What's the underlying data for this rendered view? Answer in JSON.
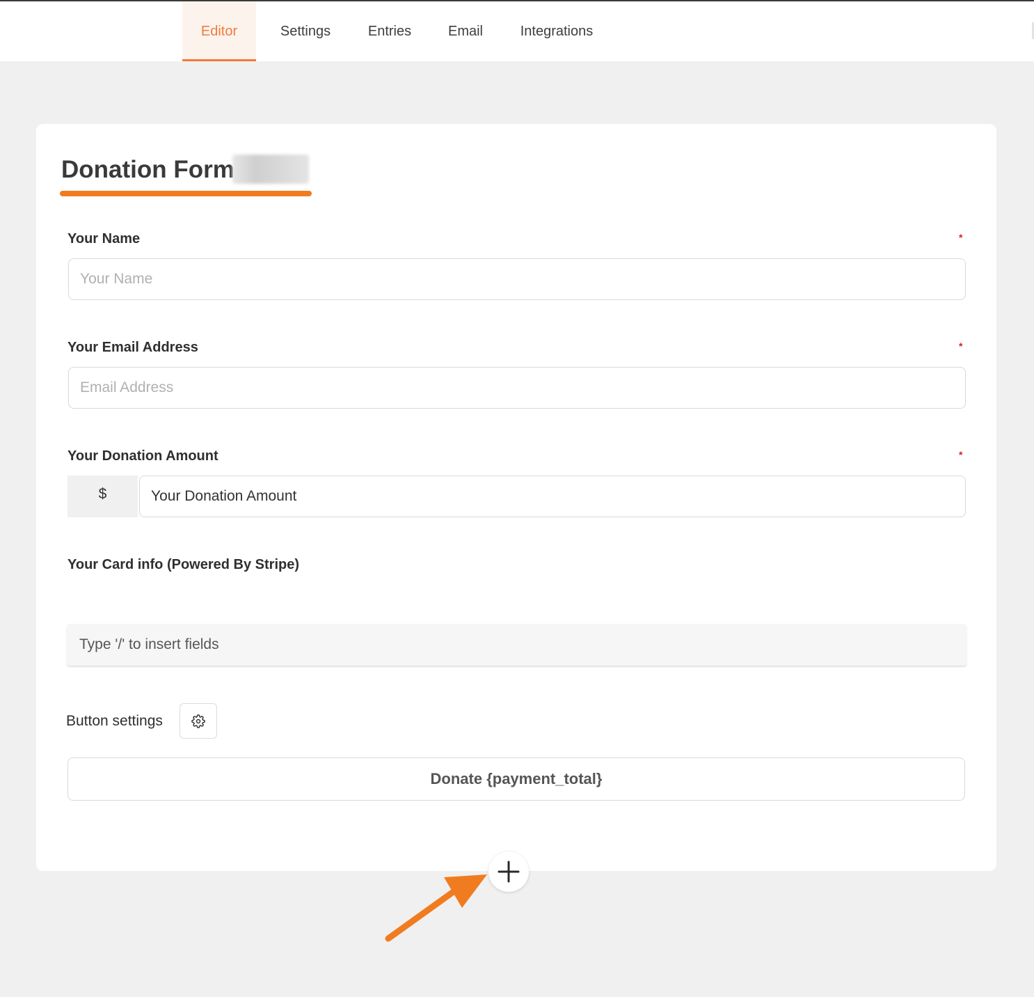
{
  "tabs": [
    {
      "label": "Editor",
      "active": true
    },
    {
      "label": "Settings",
      "active": false
    },
    {
      "label": "Entries",
      "active": false
    },
    {
      "label": "Email",
      "active": false
    },
    {
      "label": "Integrations",
      "active": false
    }
  ],
  "form": {
    "title": "Donation Form",
    "required_mark": "*",
    "name_label": "Your Name",
    "name_placeholder": "Your Name",
    "email_label": "Your Email Address",
    "email_placeholder": "Email Address",
    "amount_label": "Your Donation Amount",
    "currency_symbol": "$",
    "amount_value": "Your Donation Amount",
    "card_label": "Your Card info (Powered By Stripe)",
    "insert_hint": "Type '/' to insert fields",
    "button_settings_label": "Button settings",
    "submit_label": "Donate {payment_total}"
  },
  "colors": {
    "accent": "#f07c3a",
    "arrow": "#f07c1f",
    "required": "#d62222"
  },
  "icons": {
    "settings": "gear-icon",
    "add": "plus-icon",
    "annotation": "arrow-annotation"
  }
}
